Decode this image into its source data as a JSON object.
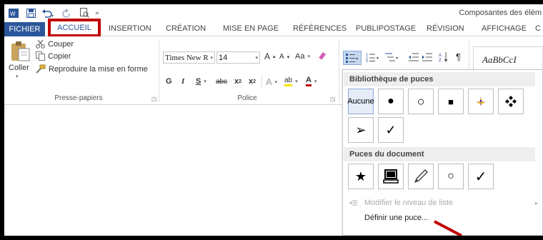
{
  "window": {
    "title": "Composantes des élém"
  },
  "quick_access": {
    "app_icon": "word-icon",
    "save_icon": "save-icon",
    "undo_icon": "undo-icon",
    "redo_icon": "redo-icon",
    "print_preview_icon": "print-preview-icon",
    "customize_icon": "customize-qat-icon"
  },
  "tabs": [
    {
      "label": "FICHIER"
    },
    {
      "label": "ACCUEIL"
    },
    {
      "label": "INSERTION"
    },
    {
      "label": "CRÉATION"
    },
    {
      "label": "MISE EN PAGE"
    },
    {
      "label": "RÉFÉRENCES"
    },
    {
      "label": "PUBLIPOSTAGE"
    },
    {
      "label": "RÉVISION"
    },
    {
      "label": "AFFICHAGE"
    },
    {
      "label": "C"
    }
  ],
  "ribbon": {
    "clipboard": {
      "paste_label": "Coller",
      "cut_label": "Couper",
      "copy_label": "Copier",
      "format_painter_label": "Reproduire la mise en forme",
      "group_label": "Presse-papiers"
    },
    "font": {
      "font_name": "Times New R",
      "font_size": "14",
      "grow_label": "A",
      "shrink_label": "A",
      "case_label": "Aa",
      "bold": "G",
      "italic": "I",
      "underline": "S",
      "strike": "abc",
      "subscript": "x",
      "sub_digit": "2",
      "superscript": "x",
      "sup_digit": "2",
      "effects_label": "A",
      "highlight_label": "ab",
      "font_color_label": "A",
      "group_label": "Police"
    },
    "styles": {
      "preview": "AaBbCcI"
    },
    "paragraph": {
      "pilcrow": "¶"
    }
  },
  "bullet_menu": {
    "library_header": "Bibliothèque de puces",
    "library": [
      "Aucune",
      "●",
      "○",
      "■",
      "",
      "",
      "➢",
      "✓"
    ],
    "document_header": "Puces du document",
    "document": [
      "★",
      "",
      "",
      "○",
      "✓"
    ],
    "change_level": "Modifier le niveau de liste",
    "define": "Définir une puce..."
  },
  "colors": {
    "accent": "#2b579a",
    "highlight_box": "#c00000",
    "annotation_arrow": "#c00000"
  }
}
